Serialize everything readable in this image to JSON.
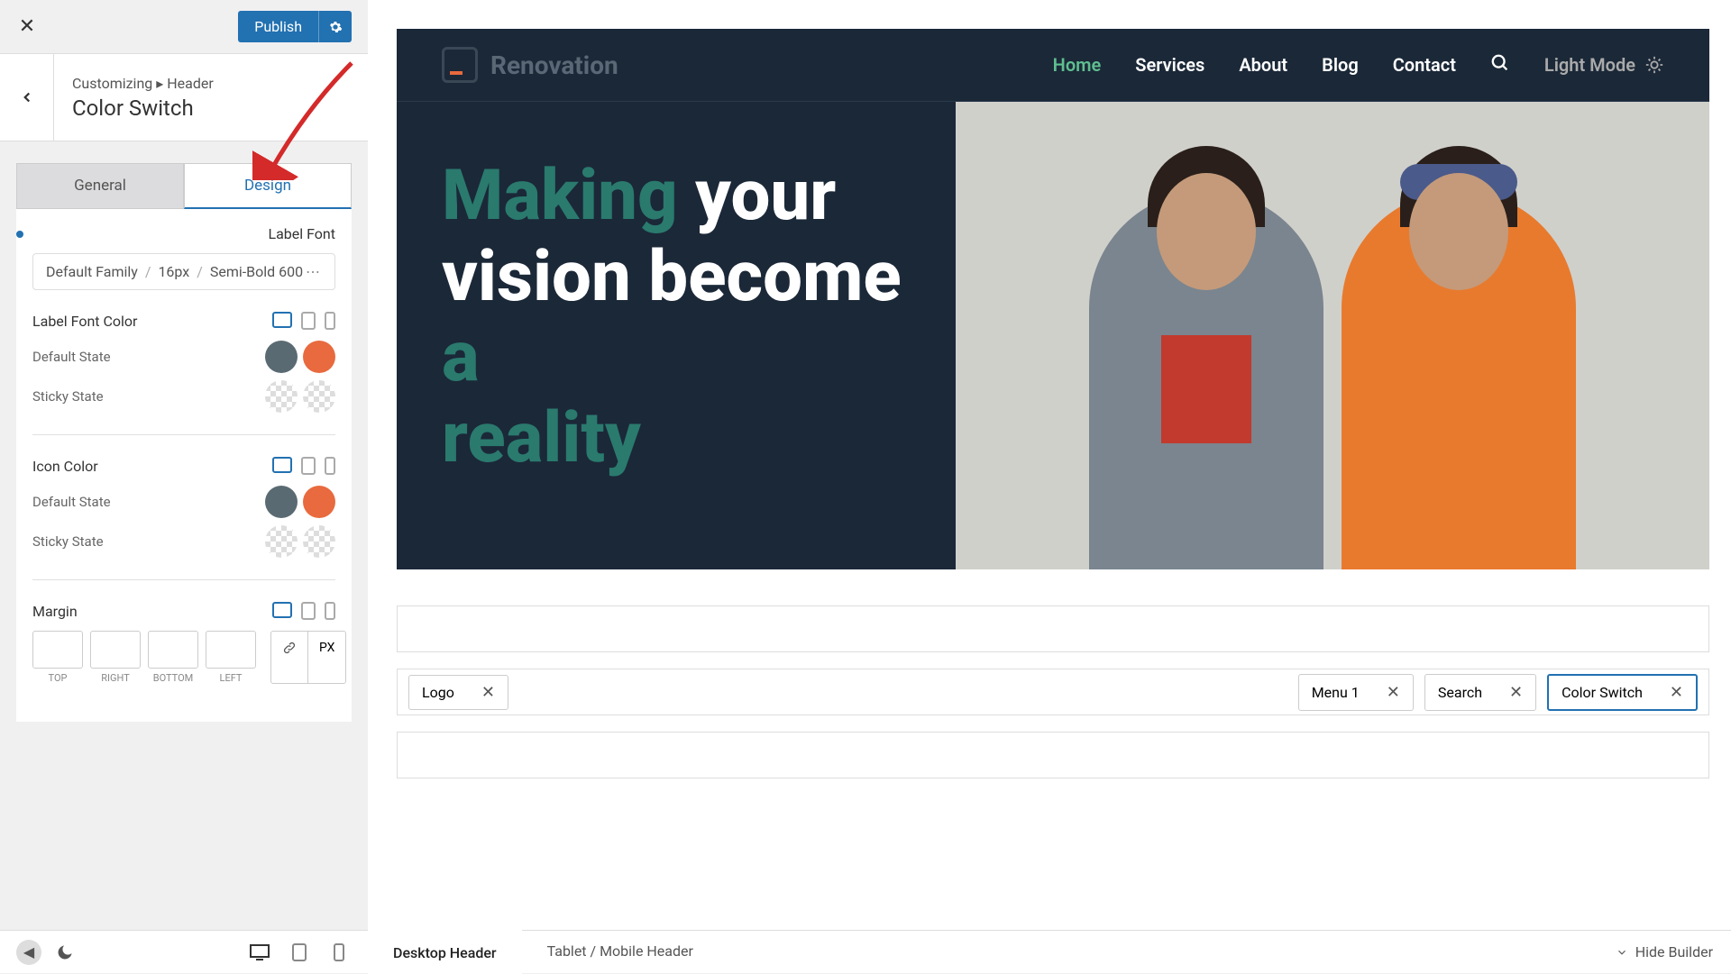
{
  "topbar": {
    "publish_label": "Publish"
  },
  "breadcrumb": {
    "root": "Customizing",
    "section": "Header",
    "title": "Color Switch"
  },
  "tabs": {
    "general": "General",
    "design": "Design"
  },
  "labelFont": {
    "title": "Label Font",
    "family": "Default Family",
    "size": "16px",
    "weight": "Semi-Bold 600"
  },
  "labelFontColor": {
    "title": "Label Font Color",
    "default_state": "Default State",
    "sticky_state": "Sticky State",
    "default_colors": [
      "#5a6a72",
      "#e86a3e"
    ]
  },
  "iconColor": {
    "title": "Icon Color",
    "default_state": "Default State",
    "sticky_state": "Sticky State",
    "default_colors": [
      "#5a6a72",
      "#e86a3e"
    ]
  },
  "margin": {
    "title": "Margin",
    "sides": [
      "TOP",
      "RIGHT",
      "BOTTOM",
      "LEFT"
    ],
    "unit": "PX"
  },
  "preview": {
    "logo_text": "Renovation",
    "nav": [
      "Home",
      "Services",
      "About",
      "Blog",
      "Contact"
    ],
    "light_mode": "Light Mode",
    "hero": {
      "w1": "Making",
      "w2": "your",
      "w3": "vision become",
      "w4": "a",
      "w5": "reality"
    }
  },
  "builder": {
    "row2_left": [
      {
        "label": "Logo"
      }
    ],
    "row2_right": [
      {
        "label": "Menu 1"
      },
      {
        "label": "Search"
      },
      {
        "label": "Color Switch",
        "selected": true
      }
    ]
  },
  "bottom": {
    "tab1": "Desktop Header",
    "tab2": "Tablet / Mobile Header",
    "hide": "Hide Builder"
  }
}
